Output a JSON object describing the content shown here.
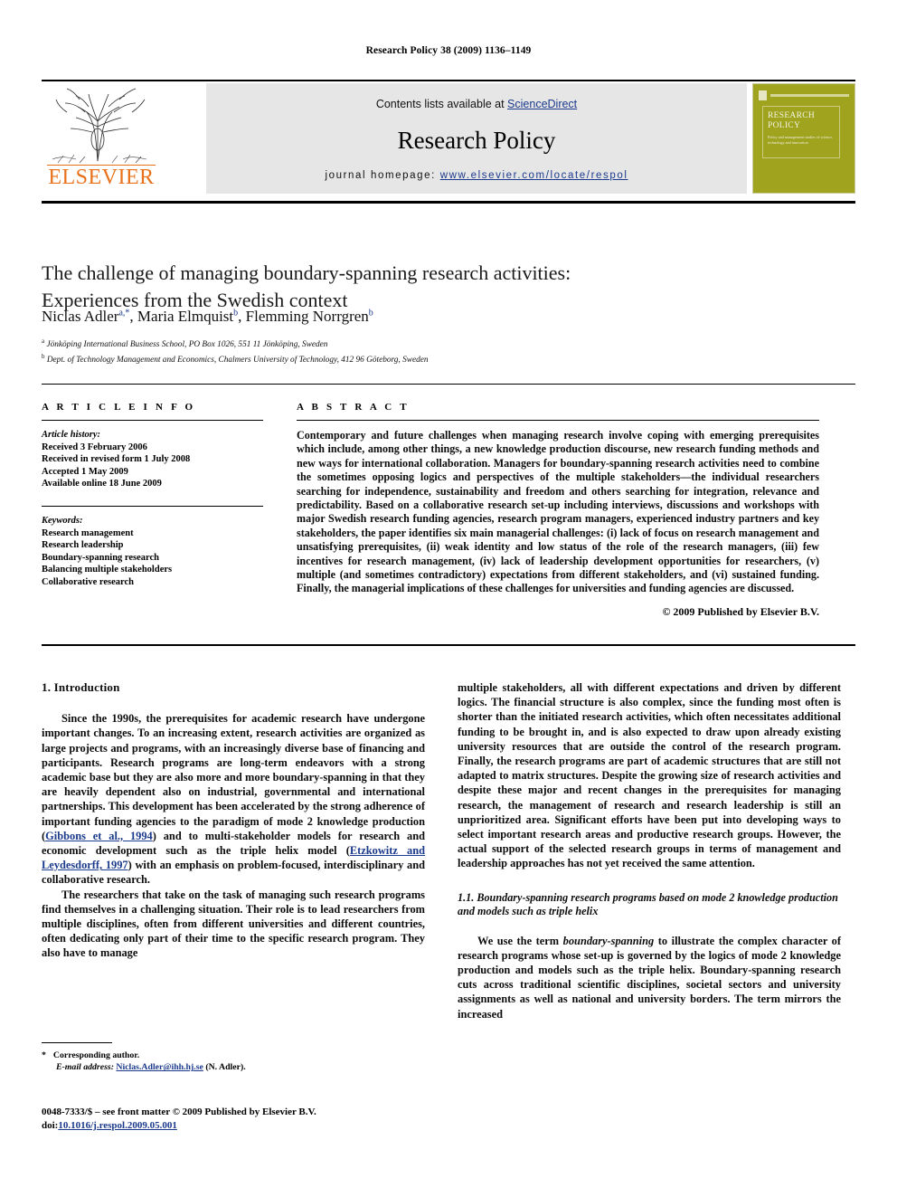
{
  "running_head": "Research Policy 38 (2009) 1136–1149",
  "masthead": {
    "publisher_wordmark": "ELSEVIER",
    "contents_prefix": "Contents lists available at ",
    "contents_link": "ScienceDirect",
    "journal_name": "Research Policy",
    "homepage_label": "journal homepage:",
    "homepage_url": "www.elsevier.com/locate/respol",
    "cover": {
      "title_line1": "RESEARCH",
      "title_line2": "POLICY",
      "subtitle": "Policy and management studies of science, technology and innovation"
    }
  },
  "article": {
    "title_line1": "The challenge of managing boundary-spanning research activities:",
    "title_line2": "Experiences from the Swedish context",
    "authors": [
      {
        "name": "Niclas Adler",
        "marks": "a,*"
      },
      {
        "name": "Maria Elmquist",
        "marks": "b"
      },
      {
        "name": "Flemming Norrgren",
        "marks": "b"
      }
    ],
    "affiliations": [
      {
        "mark": "a",
        "text": "Jönköping International Business School, PO Box 1026, 551 11 Jönköping, Sweden"
      },
      {
        "mark": "b",
        "text": "Dept. of Technology Management and Economics, Chalmers University of Technology, 412 96 Göteborg, Sweden"
      }
    ]
  },
  "info": {
    "heading": "A R T I C L E    I N F O",
    "history_label": "Article history:",
    "history": [
      "Received 3 February 2006",
      "Received in revised form 1 July 2008",
      "Accepted 1 May 2009",
      "Available online 18 June 2009"
    ],
    "keywords_label": "Keywords:",
    "keywords": [
      "Research management",
      "Research leadership",
      "Boundary-spanning research",
      "Balancing multiple stakeholders",
      "Collaborative research"
    ]
  },
  "abstract": {
    "heading": "A B S T R A C T",
    "text": "Contemporary and future challenges when managing research involve coping with emerging prerequisites which include, among other things, a new knowledge production discourse, new research funding methods and new ways for international collaboration. Managers for boundary-spanning research activities need to combine the sometimes opposing logics and perspectives of the multiple stakeholders—the individual researchers searching for independence, sustainability and freedom and others searching for integration, relevance and predictability. Based on a collaborative research set-up including interviews, discussions and workshops with major Swedish research funding agencies, research program managers, experienced industry partners and key stakeholders, the paper identifies six main managerial challenges: (i) lack of focus on research management and unsatisfying prerequisites, (ii) weak identity and low status of the role of the research managers, (iii) few incentives for research management, (iv) lack of leadership development opportunities for researchers, (v) multiple (and sometimes contradictory) expectations from different stakeholders, and (vi) sustained funding. Finally, the managerial implications of these challenges for universities and funding agencies are discussed.",
    "copyright": "© 2009 Published by Elsevier B.V."
  },
  "body": {
    "section_heading": "1.  Introduction",
    "left_paragraph_1_a": "Since the 1990s, the prerequisites for academic research have undergone important changes. To an increasing extent, research activities are organized as large projects and programs, with an increasingly diverse base of financing and participants. Research programs are long-term endeavors with a strong academic base but they are also more and more boundary-spanning in that they are heavily dependent also on industrial, governmental and international partnerships. This development has been accelerated by the strong adherence of important funding agencies to the paradigm of mode 2 knowledge production (",
    "ref_gibbons": "Gibbons et al., 1994",
    "left_paragraph_1_b": ") and to multi-stakeholder models for research and economic development such as the triple helix model (",
    "ref_etzkowitz": "Etzkowitz and Leydesdorff, 1997",
    "left_paragraph_1_c": ") with an emphasis on problem-focused, interdisciplinary and collaborative research.",
    "left_paragraph_2": "The researchers that take on the task of managing such research programs find themselves in a challenging situation. Their role is to lead researchers from multiple disciplines, often from different universities and different countries, often dedicating only part of their time to the specific research program. They also have to manage",
    "right_paragraph_1": "multiple stakeholders, all with different expectations and driven by different logics. The financial structure is also complex, since the funding most often is shorter than the initiated research activities, which often necessitates additional funding to be brought in, and is also expected to draw upon already existing university resources that are outside the control of the research program. Finally, the research programs are part of academic structures that are still not adapted to matrix structures. Despite the growing size of research activities and despite these major and recent changes in the prerequisites for managing research, the management of research and research leadership is still an unprioritized area. Significant efforts have been put into developing ways to select important research areas and productive research groups. However, the actual support of the selected research groups in terms of management and leadership approaches has not yet received the same attention.",
    "subsection_heading": "1.1.  Boundary-spanning research programs based on mode 2 knowledge production and models such as triple helix",
    "right_paragraph_2_a": "We use the term ",
    "right_paragraph_2_em": "boundary-spanning",
    "right_paragraph_2_b": " to illustrate the complex character of research programs whose set-up is governed by the logics of mode 2 knowledge production and models such as the triple helix. Boundary-spanning research cuts across traditional scientific disciplines, societal sectors and university assignments as well as national and university borders. The term mirrors the increased"
  },
  "footnote": {
    "star": "*",
    "corresponding": "Corresponding author.",
    "email_label": "E-mail address:",
    "email": "Niclas.Adler@ihh.hj.se",
    "email_suffix": "(N. Adler)."
  },
  "footer": {
    "issn_line": "0048-7333/$ – see front matter © 2009 Published by Elsevier B.V.",
    "doi_label": "doi:",
    "doi": "10.1016/j.respol.2009.05.001"
  }
}
